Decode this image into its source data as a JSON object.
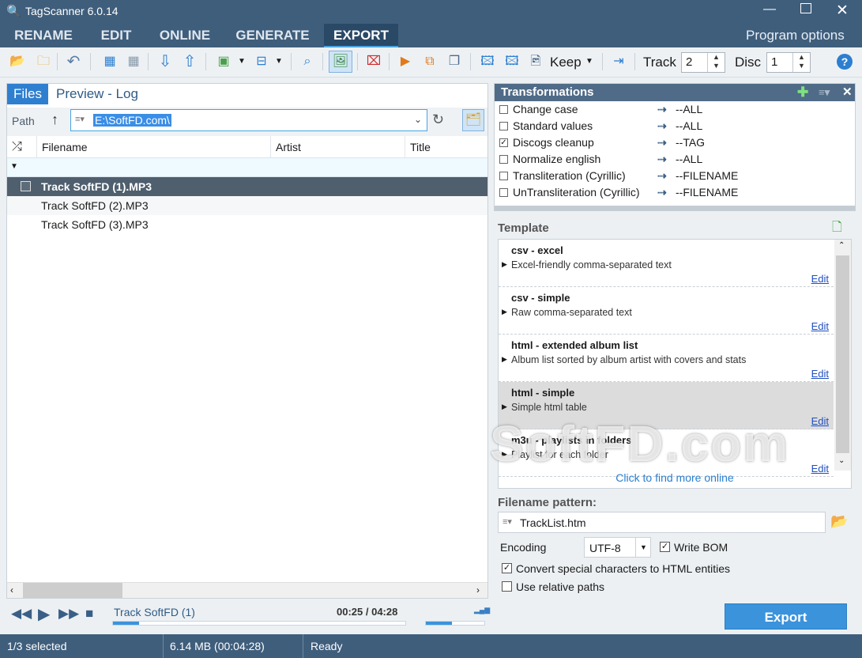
{
  "app": {
    "title": "TagScanner 6.0.14"
  },
  "menu": {
    "tabs": [
      "RENAME",
      "EDIT",
      "ONLINE",
      "GENERATE",
      "EXPORT"
    ],
    "active": "EXPORT",
    "program_options": "Program options"
  },
  "toolbar": {
    "keep_label": "Keep",
    "track_label": "Track",
    "track_value": "2",
    "disc_label": "Disc",
    "disc_value": "1"
  },
  "files_panel": {
    "tabs": [
      "Files",
      "Preview - Log"
    ],
    "path_label": "Path",
    "path_value": "E:\\SoftFD.com\\",
    "columns": [
      "Filename",
      "Artist",
      "Title"
    ],
    "rows": [
      "Track SoftFD (1).MP3",
      "Track SoftFD (2).MP3",
      "Track SoftFD (3).MP3"
    ]
  },
  "player": {
    "track": "Track SoftFD (1)",
    "time": "00:25 / 04:28",
    "progress": 0.09
  },
  "status": {
    "selected": "1/3 selected",
    "size": "6.14 MB (00:04:28)",
    "state": "Ready"
  },
  "transformations": {
    "title": "Transformations",
    "items": [
      {
        "name": "Change case",
        "target": "--ALL",
        "checked": false
      },
      {
        "name": "Standard values",
        "target": "--ALL",
        "checked": false
      },
      {
        "name": "Discogs cleanup",
        "target": "--TAG",
        "checked": true
      },
      {
        "name": "Normalize english",
        "target": "--ALL",
        "checked": false
      },
      {
        "name": "Transliteration (Cyrillic)",
        "target": "--FILENAME",
        "checked": false
      },
      {
        "name": "UnTransliteration (Cyrillic)",
        "target": "--FILENAME",
        "checked": false
      }
    ]
  },
  "template": {
    "title": "Template",
    "items": [
      {
        "name": "csv - excel",
        "desc": "Excel-friendly comma-separated text",
        "edit": "Edit"
      },
      {
        "name": "csv - simple",
        "desc": "Raw comma-separated text",
        "edit": "Edit"
      },
      {
        "name": "html - extended album list",
        "desc": "Album list sorted by album artist with covers and stats",
        "edit": "Edit"
      },
      {
        "name": "html - simple",
        "desc": "Simple html table",
        "edit": "Edit"
      },
      {
        "name": "m3u - playlists in folders",
        "desc": "Playlist for each folder",
        "edit": "Edit"
      }
    ],
    "more": "Click to find more online"
  },
  "options": {
    "filename_pattern_label": "Filename pattern:",
    "filename_pattern": "TrackList.htm",
    "encoding_label": "Encoding",
    "encoding_value": "UTF-8",
    "write_bom": "Write BOM",
    "convert_special": "Convert special characters to HTML entities",
    "relative_paths": "Use relative paths",
    "export_button": "Export"
  },
  "watermark": "SoftFD.com"
}
